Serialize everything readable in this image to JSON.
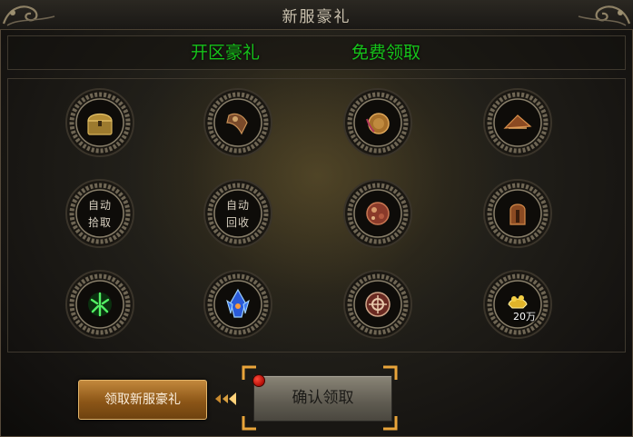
{
  "title": "新服豪礼",
  "header": {
    "left": "开区豪礼",
    "right": "免费领取"
  },
  "items": [
    {
      "kind": "icon",
      "icon": "treasure-chest-icon"
    },
    {
      "kind": "icon",
      "icon": "bracer-icon"
    },
    {
      "kind": "icon",
      "icon": "amulet-icon"
    },
    {
      "kind": "icon",
      "icon": "hat-icon"
    },
    {
      "kind": "text",
      "line1": "自动",
      "line2": "拾取"
    },
    {
      "kind": "text",
      "line1": "自动",
      "line2": "回收"
    },
    {
      "kind": "icon",
      "icon": "gem-orb-icon"
    },
    {
      "kind": "icon",
      "icon": "helmet-icon"
    },
    {
      "kind": "icon",
      "icon": "green-rune-icon"
    },
    {
      "kind": "icon",
      "icon": "blue-crystal-icon"
    },
    {
      "kind": "icon",
      "icon": "medal-icon"
    },
    {
      "kind": "icon",
      "icon": "gold-ingot-icon",
      "amount": "20万"
    }
  ],
  "buttons": {
    "claim": "领取新服豪礼",
    "confirm": "确认领取"
  },
  "colors": {
    "header_green": "#16c21a",
    "claim_orange": "#a86a22",
    "frame_gold": "#e9a43a",
    "badge_red": "#d51a0e"
  }
}
